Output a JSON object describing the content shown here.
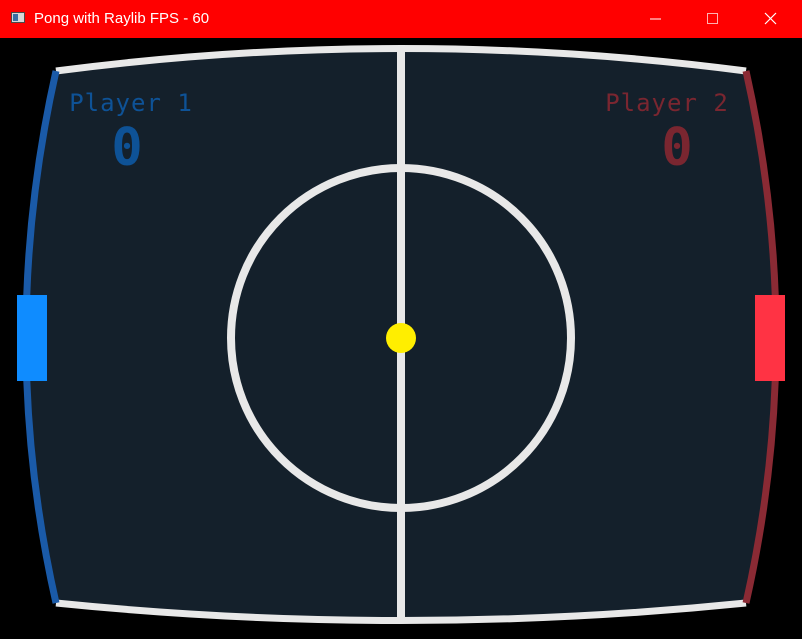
{
  "window": {
    "title": "Pong with Raylib FPS - 60",
    "titlebar_color": "#ff0000",
    "icons": {
      "app": "app-window-icon",
      "minimize": "minimize-icon",
      "maximize": "maximize-icon",
      "close": "close-icon"
    }
  },
  "game": {
    "background_color": "#14202b",
    "line_color": "#e8e8e8",
    "player1": {
      "name": "Player 1",
      "score": "0",
      "color": "#0e5296",
      "paddle_color": "#0f8cff",
      "border_color": "#1a5aa8"
    },
    "player2": {
      "name": "Player 2",
      "score": "0",
      "color": "#7a2630",
      "paddle_color": "#ff3344",
      "border_color": "#8a2a34"
    },
    "ball_color": "#ffee00"
  }
}
